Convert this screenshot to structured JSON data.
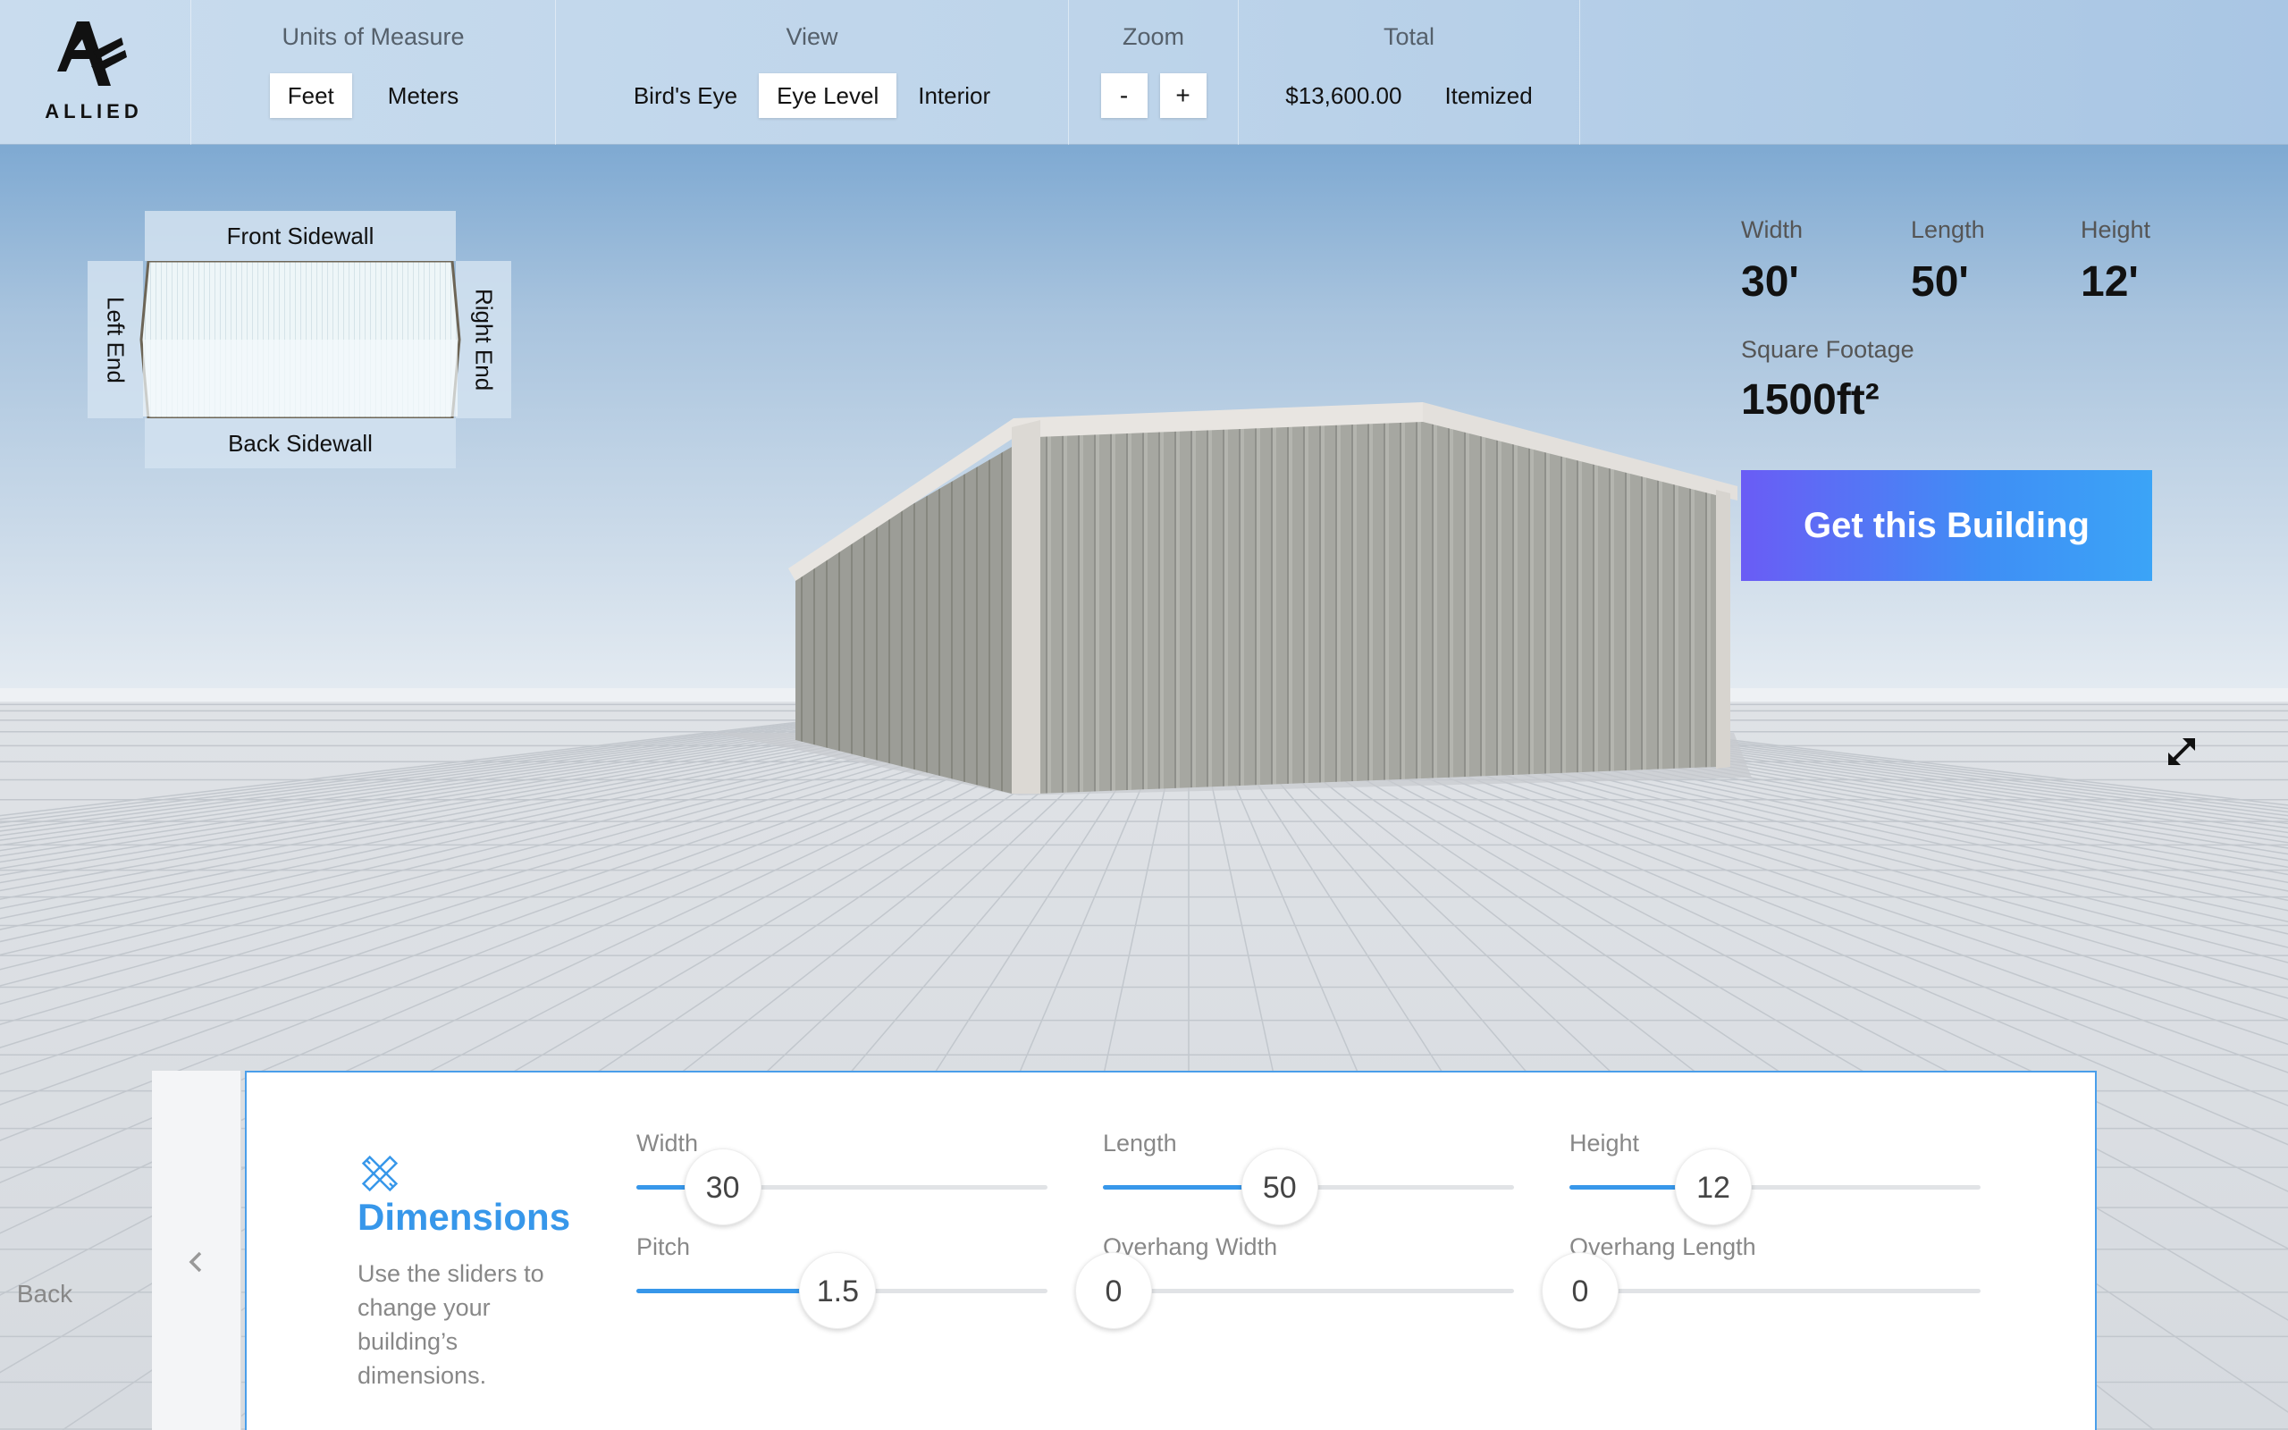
{
  "brand": {
    "logo_text": "ALLIED"
  },
  "toolbar": {
    "units": {
      "title": "Units of Measure",
      "feet": "Feet",
      "meters": "Meters",
      "selected": "Feet"
    },
    "view": {
      "title": "View",
      "birds_eye": "Bird's Eye",
      "eye_level": "Eye Level",
      "interior": "Interior",
      "selected": "Eye Level"
    },
    "zoom": {
      "title": "Zoom",
      "minus": "-",
      "plus": "+"
    },
    "total": {
      "title": "Total",
      "amount": "$13,600.00",
      "itemized": "Itemized"
    }
  },
  "minimap": {
    "front": "Front Sidewall",
    "back": "Back Sidewall",
    "left": "Left End",
    "right": "Right End"
  },
  "stats": {
    "width_label": "Width",
    "width_value": "30'",
    "length_label": "Length",
    "length_value": "50'",
    "height_label": "Height",
    "height_value": "12'",
    "sqft_label": "Square Footage",
    "sqft_value": "1500ft²"
  },
  "cta": {
    "label": "Get this Building"
  },
  "panel": {
    "back_label": "Back",
    "title": "Dimensions",
    "description": "Use the sliders to change your building’s dimensions.",
    "sliders": [
      {
        "label": "Width",
        "value": "30",
        "fraction": 0.21
      },
      {
        "label": "Length",
        "value": "50",
        "fraction": 0.43
      },
      {
        "label": "Height",
        "value": "12",
        "fraction": 0.35
      },
      {
        "label": "Pitch",
        "value": "1.5",
        "fraction": 0.49
      },
      {
        "label": "Overhang Width",
        "value": "0",
        "fraction": 0.0
      },
      {
        "label": "Overhang Length",
        "value": "0",
        "fraction": 0.0
      }
    ]
  },
  "colors": {
    "accent": "#3797ea",
    "cta_start": "#6a5cf5",
    "cta_end": "#3ba4f7",
    "building_wall": "#a9aaa4",
    "building_trim": "#e6e3df"
  },
  "icons": {
    "expand": "expand-arrows-icon",
    "back": "chevron-left-icon",
    "dimensions": "ruler-pencil-icon"
  }
}
